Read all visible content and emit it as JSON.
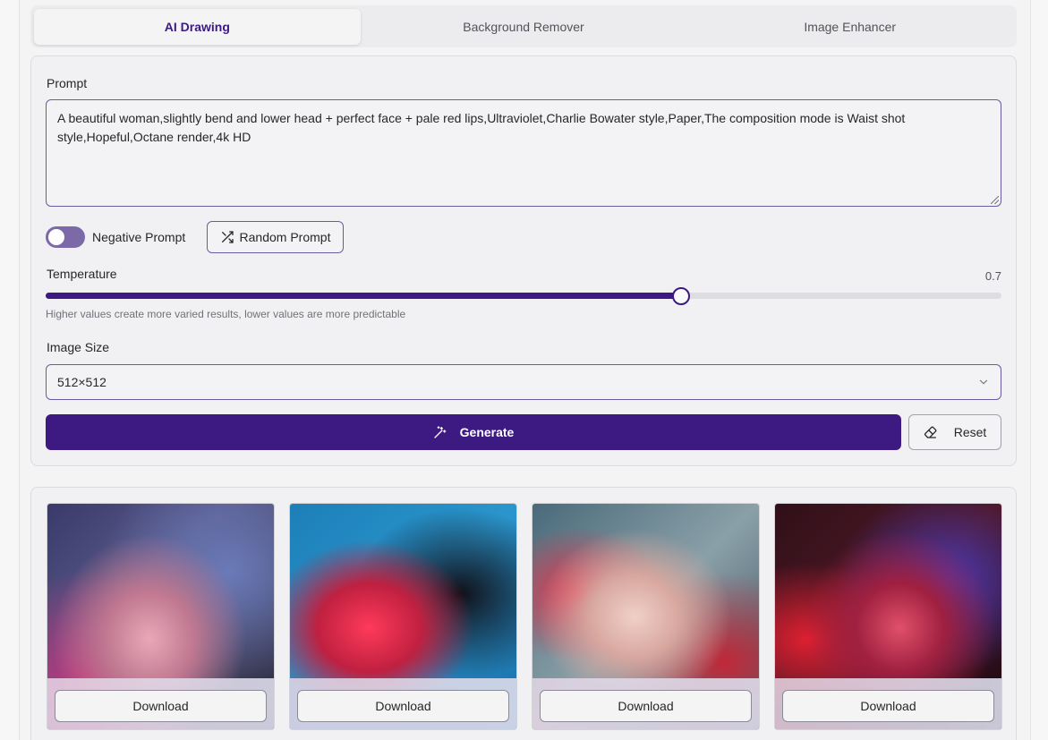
{
  "tabs": [
    {
      "label": "AI Drawing",
      "active": true
    },
    {
      "label": "Background Remover",
      "active": false
    },
    {
      "label": "Image Enhancer",
      "active": false
    }
  ],
  "form": {
    "prompt_label": "Prompt",
    "prompt_value": "A beautiful woman,slightly bend and lower head + perfect face + pale red lips,Ultraviolet,Charlie Bowater style,Paper,The composition mode is Waist shot style,Hopeful,Octane render,4k HD",
    "negative_prompt_label": "Negative Prompt",
    "negative_prompt_enabled": false,
    "random_prompt_label": "Random Prompt",
    "temperature_label": "Temperature",
    "temperature_value": "0.7",
    "temperature_level": 0.7,
    "temperature_hint": "Higher values create more varied results, lower values are more predictable",
    "image_size_label": "Image Size",
    "image_size_value": "512×512",
    "generate_label": "Generate",
    "reset_label": "Reset"
  },
  "results": [
    {
      "download_label": "Download"
    },
    {
      "download_label": "Download"
    },
    {
      "download_label": "Download"
    },
    {
      "download_label": "Download"
    }
  ],
  "colors": {
    "accent": "#3d1a82",
    "active_tab_text": "#3b1a87",
    "toggle_off": "#7c6aa8"
  },
  "icons": {
    "random": "shuffle-icon",
    "generate": "magic-wand-icon",
    "reset": "eraser-icon",
    "select": "chevron-down-icon"
  }
}
